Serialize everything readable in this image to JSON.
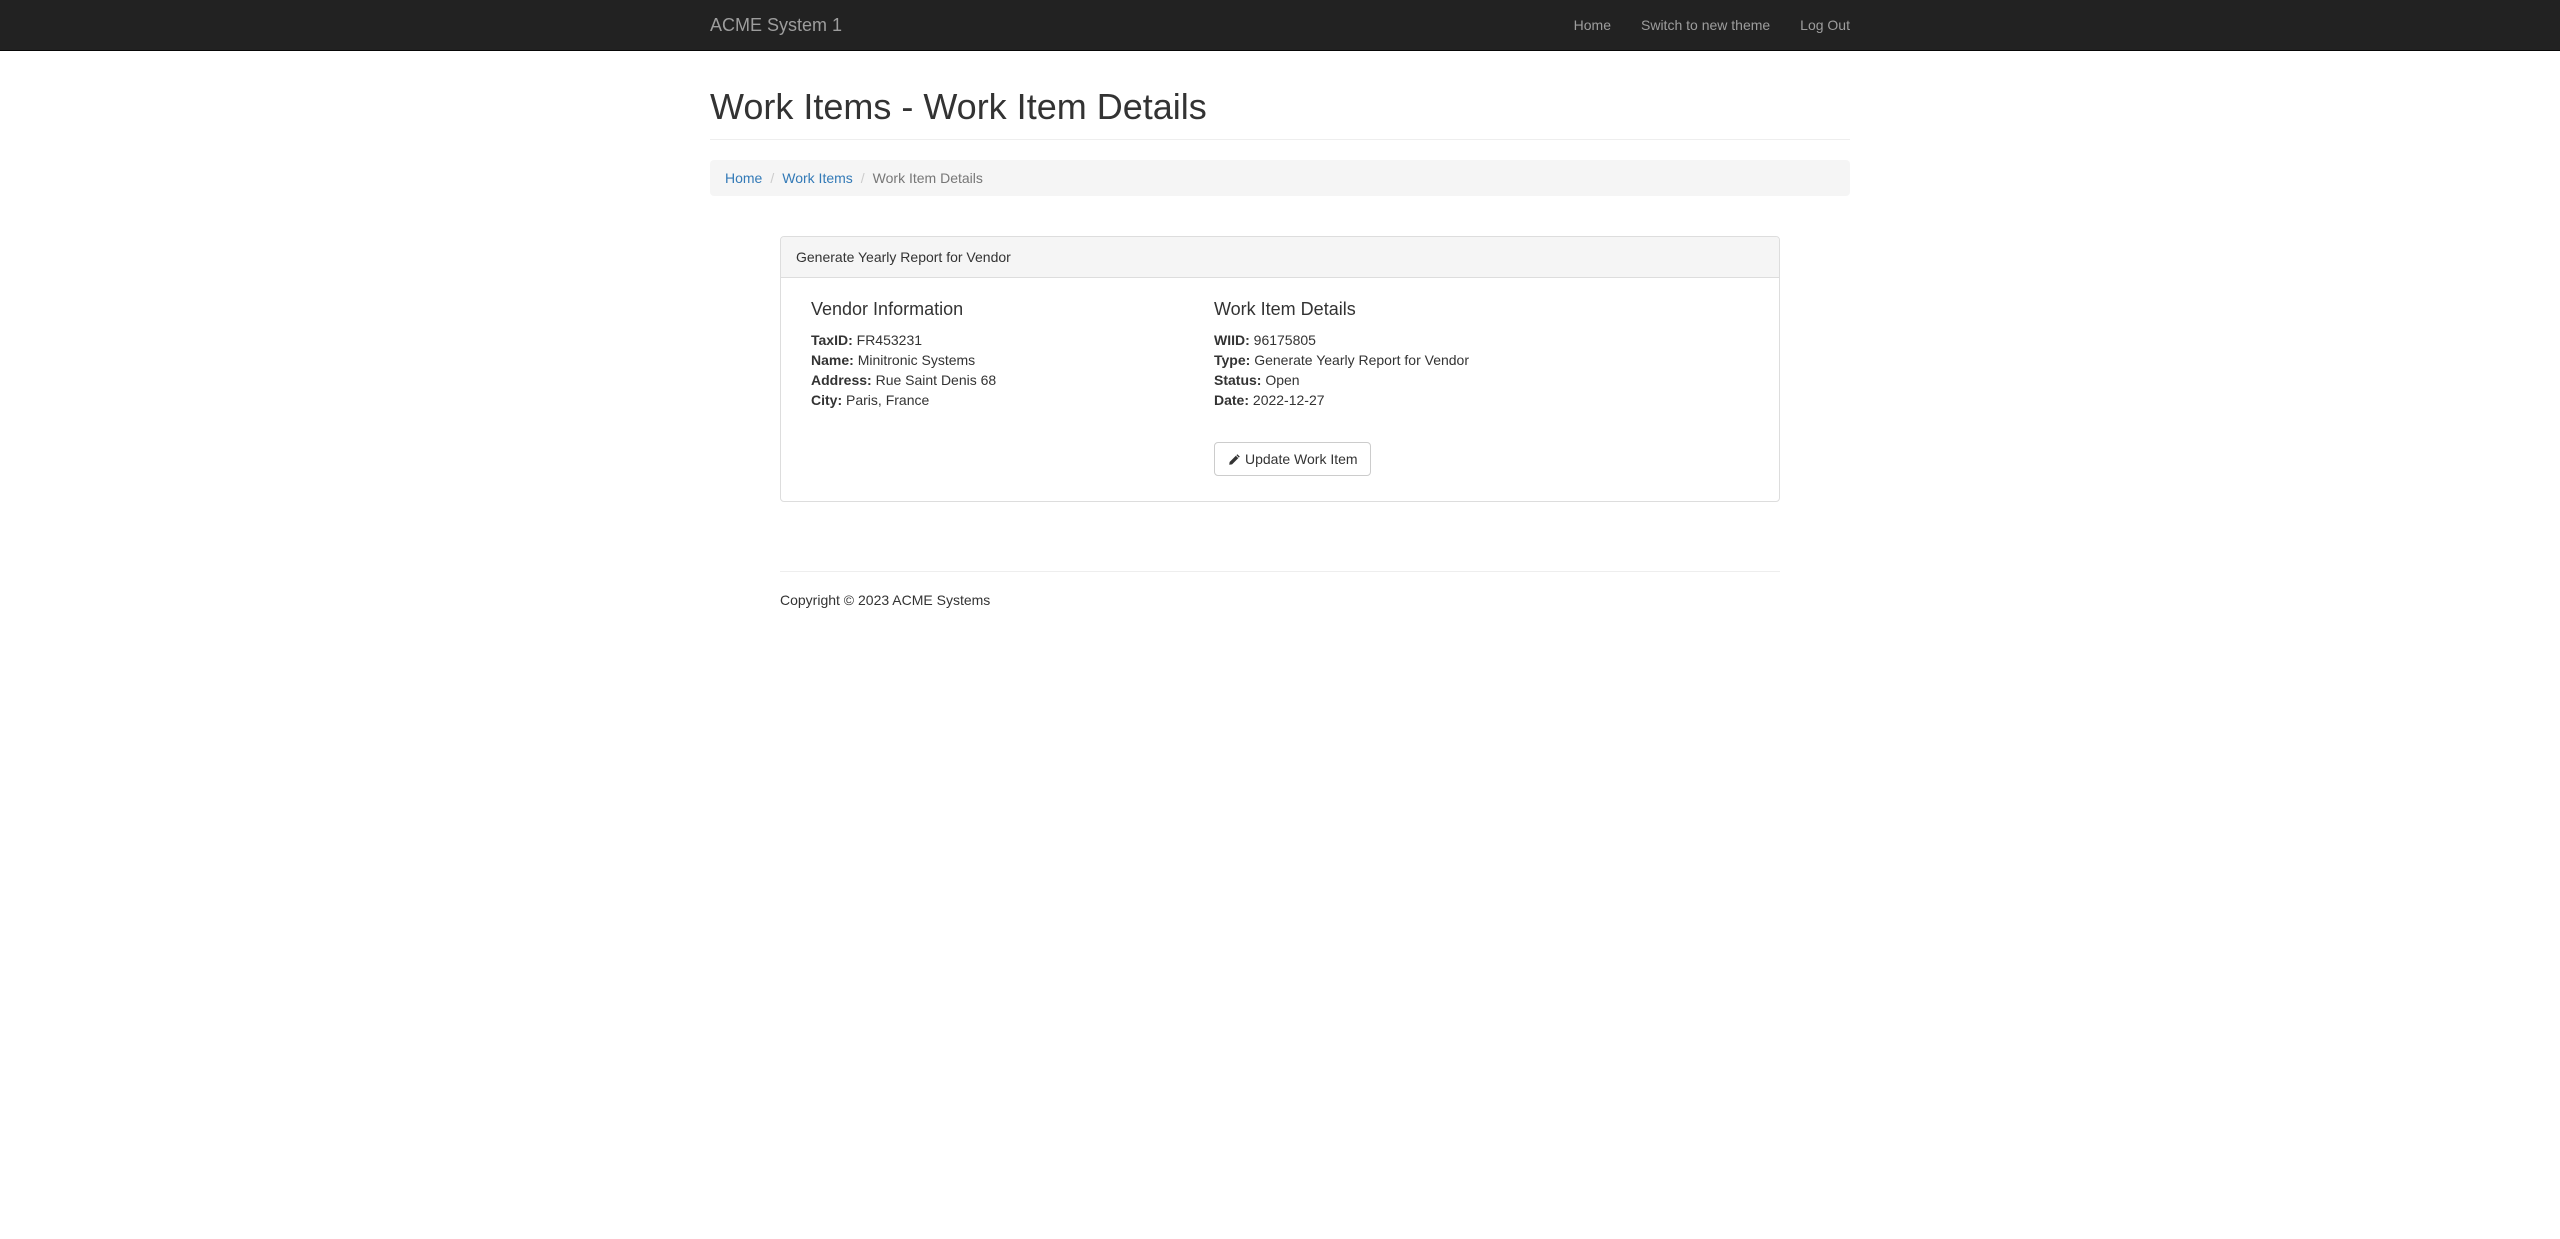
{
  "navbar": {
    "brand": "ACME System 1",
    "links": [
      "Home",
      "Switch to new theme",
      "Log Out"
    ]
  },
  "page": {
    "title": "Work Items - Work Item Details"
  },
  "breadcrumb": {
    "items": [
      "Home",
      "Work Items"
    ],
    "active": "Work Item Details"
  },
  "panel": {
    "heading": "Generate Yearly Report for Vendor",
    "vendor": {
      "title": "Vendor Information",
      "fields": [
        {
          "label": "TaxID:",
          "value": "FR453231"
        },
        {
          "label": "Name:",
          "value": "Minitronic Systems"
        },
        {
          "label": "Address:",
          "value": "Rue Saint Denis 68"
        },
        {
          "label": "City:",
          "value": "Paris, France"
        }
      ]
    },
    "work_item": {
      "title": "Work Item Details",
      "fields": [
        {
          "label": "WIID:",
          "value": "96175805"
        },
        {
          "label": "Type:",
          "value": "Generate Yearly Report for Vendor"
        },
        {
          "label": "Status:",
          "value": "Open"
        },
        {
          "label": "Date:",
          "value": "2022-12-27"
        }
      ]
    },
    "update_button": "Update Work Item",
    "update_icon": "pencil-icon"
  },
  "footer": {
    "copyright": "Copyright © 2023 ACME Systems"
  }
}
